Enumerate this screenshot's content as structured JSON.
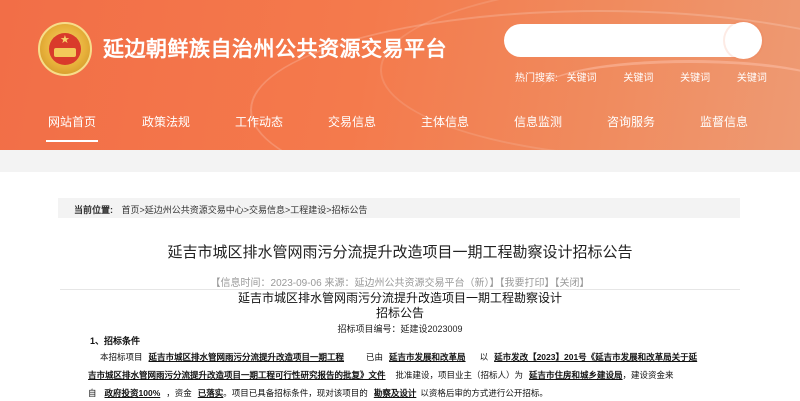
{
  "header": {
    "site_title": "延边朝鲜族自治州公共资源交易平台",
    "search_placeholder": "",
    "hot_label": "热门搜索:",
    "hot_keywords": [
      "关键词",
      "关键词",
      "关键词",
      "关键词"
    ]
  },
  "nav": {
    "items": [
      {
        "label": "网站首页"
      },
      {
        "label": "政策法规"
      },
      {
        "label": "工作动态"
      },
      {
        "label": "交易信息"
      },
      {
        "label": "主体信息"
      },
      {
        "label": "信息监测"
      },
      {
        "label": "咨询服务"
      },
      {
        "label": "监督信息"
      }
    ]
  },
  "breadcrumb": {
    "label": "当前位置:",
    "path": "首页>延边州公共资源交易中心>交易信息>工程建设>招标公告"
  },
  "article": {
    "title": "延吉市城区排水管网雨污分流提升改造项目一期工程勘察设计招标公告",
    "meta": "【信息时间：2023-09-06 来源：延边州公共资源交易平台（新）】【我要打印】【关闭】",
    "doc_title_line1": "延吉市城区排水管网雨污分流提升改造项目一期工程勘察设计",
    "doc_title_line2": "招标公告",
    "doc_number": "招标项目编号：延建设2023009",
    "section1_heading": "1、招标条件",
    "line1_a": "本招标项目",
    "line1_b": "延吉市城区排水管网雨污分流提升改造项目一期工程",
    "line1_c": "已由",
    "line1_d": "延吉市发展和改革局",
    "line1_e": "以",
    "line1_f": "延市发改【2023】201号《延吉市发展和改革局关于延",
    "line2_a": "吉市城区排水管网雨污分流提升改造项目一期工程可行性研究报告的批复》文件",
    "line2_b": "批准建设，项目业主（招标人）为",
    "line2_c": "延吉市住房和城乡建设局",
    "line2_d": "，建设资金来",
    "line3_a": "自",
    "line3_b": "政府投资100%",
    "line3_c": "，资金",
    "line3_d": "已落实",
    "line3_e": "。项目已具备招标条件，现对该项目的",
    "line3_f": "勘察及设计",
    "line3_g": "以资格后审的方式进行公开招标。"
  },
  "colors": {
    "header_orange": "#f26e47",
    "band_gray": "#f3f3f3",
    "text_dark": "#222222",
    "meta_gray": "#999999"
  }
}
